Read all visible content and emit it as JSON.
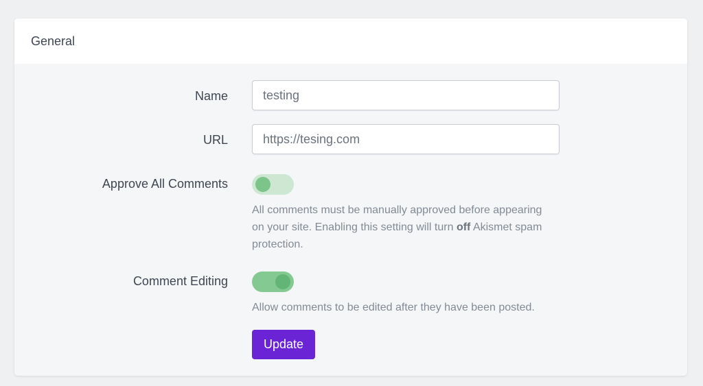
{
  "section": {
    "title": "General"
  },
  "form": {
    "name_label": "Name",
    "name_value": "testing",
    "url_label": "URL",
    "url_value": "https://tesing.com",
    "approve_label": "Approve All Comments",
    "approve_enabled": false,
    "approve_help_before": "All comments must be manually approved before appearing on your site. Enabling this setting will turn ",
    "approve_help_bold": "off",
    "approve_help_after": " Akismet spam protection.",
    "editing_label": "Comment Editing",
    "editing_enabled": true,
    "editing_help": "Allow comments to be edited after they have been posted.",
    "update_label": "Update"
  },
  "colors": {
    "accent": "#6a24d6",
    "toggle_on": "#84c992",
    "toggle_off": "#cde7d2"
  }
}
